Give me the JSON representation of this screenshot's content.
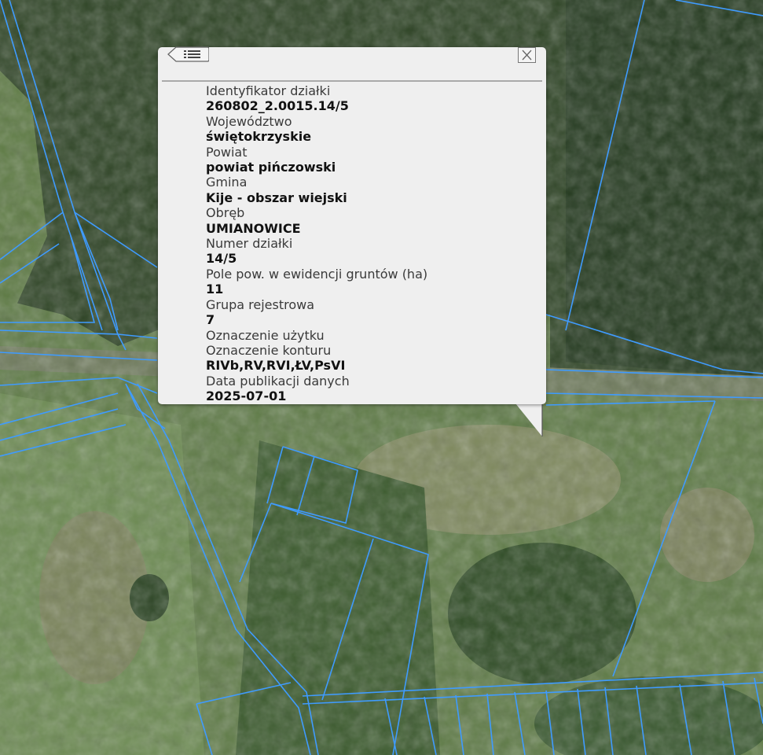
{
  "parcel": {
    "rows": [
      {
        "label": "Identyfikator działki",
        "value": "260802_2.0015.14/5"
      },
      {
        "label": "Województwo",
        "value": "świętokrzyskie"
      },
      {
        "label": "Powiat",
        "value": "powiat pińczowski"
      },
      {
        "label": "Gmina",
        "value": "Kije - obszar wiejski"
      },
      {
        "label": "Obręb",
        "value": "UMIANOWICE"
      },
      {
        "label": "Numer działki",
        "value": "14/5"
      },
      {
        "label": "Pole pow. w ewidencji gruntów (ha)",
        "value": "11"
      },
      {
        "label": "Grupa rejestrowa",
        "value": "7"
      },
      {
        "label": "Oznaczenie użytku",
        "value": ""
      },
      {
        "label": "Oznaczenie konturu",
        "value": "RIVb,RV,RVI,ŁV,PsVI"
      },
      {
        "label": "Data publikacji danych",
        "value": "2025-07-01"
      }
    ]
  },
  "icons": {
    "back": "list-back-icon",
    "close": "close-icon"
  },
  "colors": {
    "parcel_boundary": "#3f9bff",
    "popup_background": "#efefef"
  }
}
